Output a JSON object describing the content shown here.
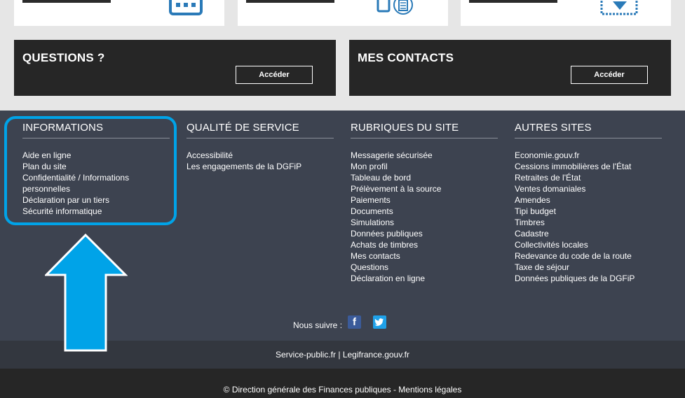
{
  "top_tiles": [
    {
      "title": "QUESTIONS ?",
      "button": "Accéder"
    },
    {
      "title": "MES CONTACTS",
      "button": "Accéder"
    }
  ],
  "top_cards": [
    {
      "icon": "calendar-icon"
    },
    {
      "icon": "mobile-document-icon"
    },
    {
      "icon": "stamp-icon"
    }
  ],
  "footer": {
    "columns": [
      {
        "title": "INFORMATIONS",
        "items": [
          "Aide en ligne",
          "Plan du site",
          "Confidentialité / Informations",
          "personnelles",
          "Déclaration par un tiers",
          "Sécurité informatique"
        ]
      },
      {
        "title": "QUALITÉ DE SERVICE",
        "items": [
          "Accessibilité",
          "Les engagements de la DGFiP"
        ]
      },
      {
        "title": "RUBRIQUES DU SITE",
        "items": [
          "Messagerie sécurisée",
          "Mon profil",
          "Tableau de bord",
          "Prélèvement à la source",
          "Paiements",
          "Documents",
          "Simulations",
          "Données publiques",
          "Achats de timbres",
          "Mes contacts",
          "Questions",
          "Déclaration en ligne"
        ]
      },
      {
        "title": "AUTRES SITES",
        "items": [
          "Economie.gouv.fr",
          "Cessions immobilières de l'État",
          "Retraites de l'État",
          "Ventes domaniales",
          "Amendes",
          "Tipi budget",
          "Timbres",
          "Cadastre",
          "Collectivités locales",
          "Redevance du code de la route",
          "Taxe de séjour",
          "Données publiques de la DGFiP"
        ]
      }
    ],
    "follow_label": "Nous suivre :",
    "social": [
      {
        "icon": "facebook-icon",
        "glyph": "f"
      },
      {
        "icon": "twitter-icon",
        "glyph": ""
      }
    ],
    "links": [
      "Service-public.fr",
      "|",
      "Legifrance.gouv.fr"
    ],
    "copyright": "© Direction générale des Finances publiques - Mentions légales"
  },
  "colors": {
    "accent": "#00a3e8",
    "footer_bg": "#3d4350",
    "tile_bg": "#262626",
    "icon_blue": "#2a7ab8"
  }
}
